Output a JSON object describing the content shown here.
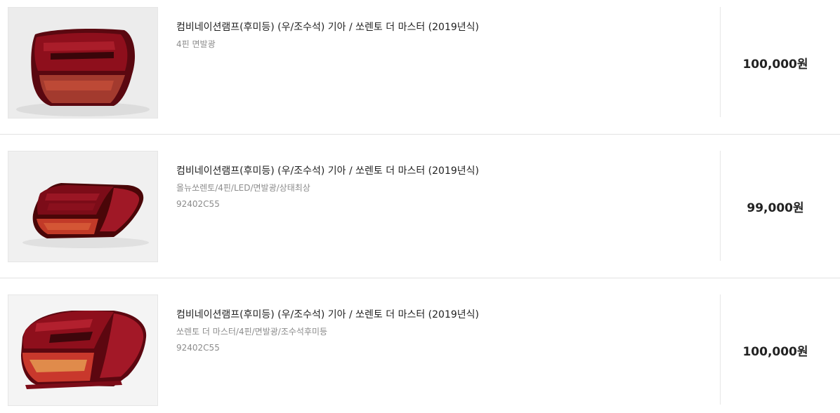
{
  "products": [
    {
      "title": "컴비네이션램프(후미등) (우/조수석) 기아 / 쏘렌토 더 마스터 (2019년식)",
      "desc": "4핀 면발광",
      "part_no": "",
      "price": "100,000원",
      "image_icon": "tail-lamp-photo"
    },
    {
      "title": "컴비네이션램프(후미등) (우/조수석) 기아 / 쏘렌토 더 마스터 (2019년식)",
      "desc": "올뉴쏘렌토/4핀/LED/면발광/상태최상",
      "part_no": "92402C55",
      "price": "99,000원",
      "image_icon": "tail-lamp-photo"
    },
    {
      "title": "컴비네이션램프(후미등) (우/조수석) 기아 / 쏘렌토 더 마스터 (2019년식)",
      "desc": "쏘렌토 더 마스터/4핀/면발광/조수석후미등",
      "part_no": "92402C55",
      "price": "100,000원",
      "image_icon": "tail-lamp-photo"
    }
  ],
  "colors": {
    "lamp_red": "#8e0f1c",
    "lamp_dark": "#3a0509",
    "lamp_amber": "#d9603a",
    "divider": "#e6e6e6"
  }
}
